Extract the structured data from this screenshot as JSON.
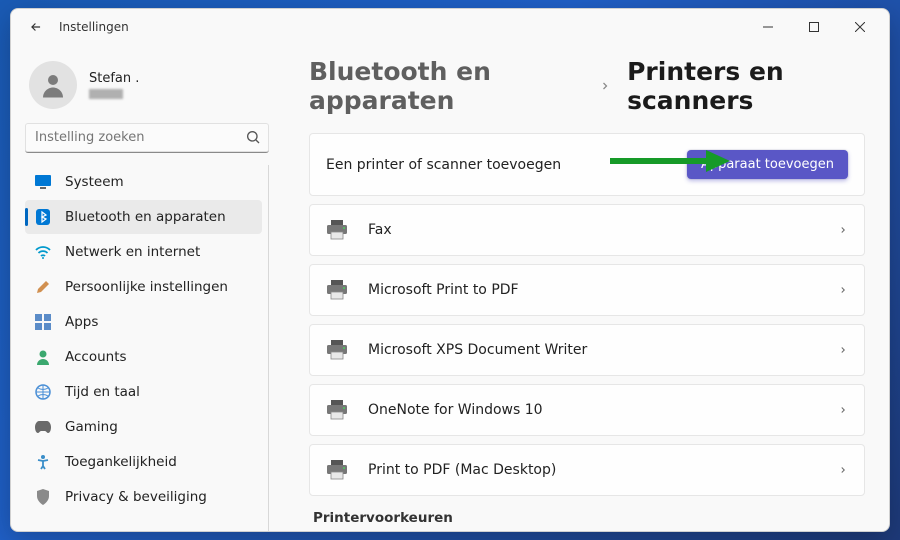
{
  "window": {
    "title": "Instellingen"
  },
  "user": {
    "name": "Stefan ."
  },
  "search": {
    "placeholder": "Instelling zoeken"
  },
  "nav": {
    "items": [
      {
        "label": "Systeem",
        "icon": "monitor",
        "active": false
      },
      {
        "label": "Bluetooth en apparaten",
        "icon": "bluetooth",
        "active": true
      },
      {
        "label": "Netwerk en internet",
        "icon": "wifi",
        "active": false
      },
      {
        "label": "Persoonlijke instellingen",
        "icon": "brush",
        "active": false
      },
      {
        "label": "Apps",
        "icon": "apps",
        "active": false
      },
      {
        "label": "Accounts",
        "icon": "person",
        "active": false
      },
      {
        "label": "Tijd en taal",
        "icon": "globe",
        "active": false
      },
      {
        "label": "Gaming",
        "icon": "game",
        "active": false
      },
      {
        "label": "Toegankelijkheid",
        "icon": "accessibility",
        "active": false
      },
      {
        "label": "Privacy & beveiliging",
        "icon": "shield",
        "active": false
      }
    ]
  },
  "breadcrumb": {
    "parent": "Bluetooth en apparaten",
    "current": "Printers en scanners"
  },
  "add": {
    "text": "Een printer of scanner toevoegen",
    "button": "Apparaat toevoegen"
  },
  "printers": [
    {
      "name": "Fax"
    },
    {
      "name": "Microsoft Print to PDF"
    },
    {
      "name": "Microsoft XPS Document Writer"
    },
    {
      "name": "OneNote for Windows 10"
    },
    {
      "name": "Print to PDF (Mac Desktop)"
    }
  ],
  "sections": {
    "prefs": "Printervoorkeuren"
  }
}
